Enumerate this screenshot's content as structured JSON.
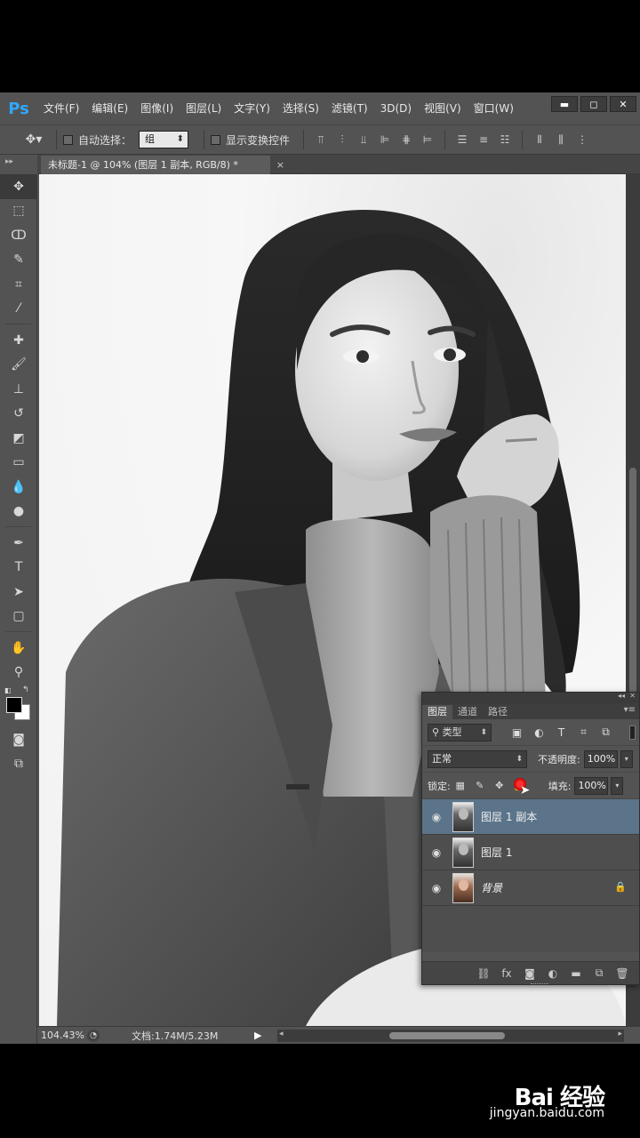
{
  "app": {
    "logo": "Ps",
    "menu": [
      "文件(F)",
      "编辑(E)",
      "图像(I)",
      "图层(L)",
      "文字(Y)",
      "选择(S)",
      "滤镜(T)",
      "3D(D)",
      "视图(V)",
      "窗口(W)"
    ],
    "window_buttons": [
      "▬",
      "◻",
      "✕"
    ]
  },
  "options": {
    "auto_select_label": "自动选择：",
    "auto_select_value": "组",
    "show_transform_label": "显示变换控件"
  },
  "document": {
    "tab_title": "未标题-1 @ 104% (图层 1 副本, RGB/8) *",
    "tab_close": "×"
  },
  "status": {
    "zoom": "104.43%",
    "doc_info": "文档:1.74M/5.23M"
  },
  "layers_panel": {
    "tabs": [
      "图层",
      "通道",
      "路径"
    ],
    "filter_type": "类型",
    "blend_mode": "正常",
    "opacity_label": "不透明度:",
    "opacity_value": "100%",
    "lock_label": "锁定:",
    "fill_label": "填充:",
    "fill_value": "100%",
    "layers": [
      {
        "name": "图层 1 副本",
        "selected": true
      },
      {
        "name": "图层 1",
        "selected": false
      },
      {
        "name": "背景",
        "selected": false,
        "locked": true
      }
    ]
  },
  "watermark": {
    "title": "Bai 经验",
    "subtitle": "jingyan.baidu.com"
  },
  "icons": {
    "eye": "eye-icon",
    "lock": "lock-icon",
    "move_tool": "move-tool-icon"
  }
}
